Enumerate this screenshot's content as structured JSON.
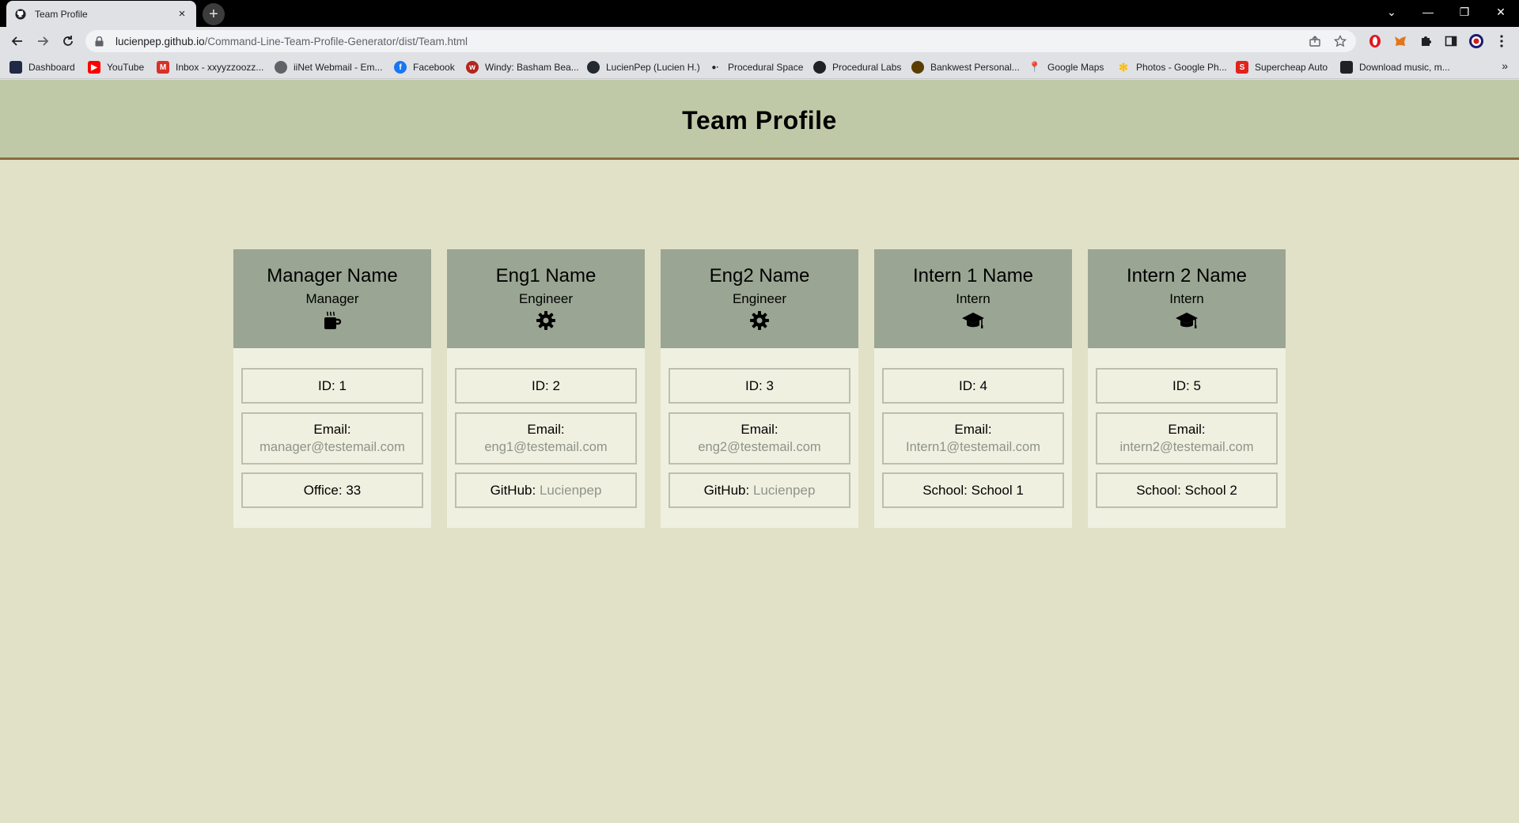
{
  "browser": {
    "tab_title": "Team Profile",
    "tab_close": "×",
    "new_tab": "+",
    "url_host": "lucienpep.github.io",
    "url_path": "/Command-Line-Team-Profile-Generator/dist/Team.html",
    "window_controls": {
      "collapse": "⌄",
      "minimize": "—",
      "restore": "❐",
      "close": "✕"
    },
    "bookmarks": [
      {
        "label": "Dashboard",
        "icon": "dashboard-icon",
        "color": "#1f2a44"
      },
      {
        "label": "YouTube",
        "icon": "youtube-icon",
        "color": "#ff0000"
      },
      {
        "label": "Inbox - xxyyzzoozz...",
        "icon": "gmail-icon",
        "color": "#d93025"
      },
      {
        "label": "iiNet Webmail - Em...",
        "icon": "iinet-icon",
        "color": "#5f6368"
      },
      {
        "label": "Facebook",
        "icon": "facebook-icon",
        "color": "#1877f2"
      },
      {
        "label": "Windy: Basham Bea...",
        "icon": "windy-icon",
        "color": "#b3261e"
      },
      {
        "label": "LucienPep (Lucien H.)",
        "icon": "github-icon",
        "color": "#24292f"
      },
      {
        "label": "Procedural Space",
        "icon": "procedural-space-icon",
        "color": "#202124"
      },
      {
        "label": "Procedural Labs",
        "icon": "procedural-labs-icon",
        "color": "#202124"
      },
      {
        "label": "Bankwest Personal...",
        "icon": "bankwest-icon",
        "color": "#5a3e00"
      },
      {
        "label": "Google Maps",
        "icon": "google-maps-icon",
        "color": "#34a853"
      },
      {
        "label": "Photos - Google Ph...",
        "icon": "google-photos-icon",
        "color": "#fbbc04"
      },
      {
        "label": "Supercheap Auto",
        "icon": "supercheap-icon",
        "color": "#e2231a"
      },
      {
        "label": "Download music, m...",
        "icon": "download-music-icon",
        "color": "#202124"
      }
    ],
    "bookmarks_more": "»"
  },
  "page": {
    "title": "Team Profile",
    "colors": {
      "background": "#e1e1c8",
      "header": "#c0c9a7",
      "header_border": "#8a6c43",
      "card_head": "#9aa693",
      "card_body": "#f0f0e1",
      "muted_text": "#8e9488"
    }
  },
  "team": [
    {
      "name": "Manager Name",
      "role": "Manager",
      "icon": "coffee-mug-icon",
      "id_label": "ID:",
      "id": "1",
      "email_label": "Email:",
      "email": "manager@testemail.com",
      "extra_label": "Office:",
      "extra": "33",
      "extra_muted": false
    },
    {
      "name": "Eng1 Name",
      "role": "Engineer",
      "icon": "gear-icon",
      "id_label": "ID:",
      "id": "2",
      "email_label": "Email:",
      "email": "eng1@testemail.com",
      "extra_label": "GitHub:",
      "extra": "Lucienpep",
      "extra_muted": true
    },
    {
      "name": "Eng2 Name",
      "role": "Engineer",
      "icon": "gear-icon",
      "id_label": "ID:",
      "id": "3",
      "email_label": "Email:",
      "email": "eng2@testemail.com",
      "extra_label": "GitHub:",
      "extra": "Lucienpep",
      "extra_muted": true
    },
    {
      "name": "Intern 1 Name",
      "role": "Intern",
      "icon": "graduation-cap-icon",
      "id_label": "ID:",
      "id": "4",
      "email_label": "Email:",
      "email": "Intern1@testemail.com",
      "extra_label": "School:",
      "extra": "School 1",
      "extra_muted": false
    },
    {
      "name": "Intern 2 Name",
      "role": "Intern",
      "icon": "graduation-cap-icon",
      "id_label": "ID:",
      "id": "5",
      "email_label": "Email:",
      "email": "intern2@testemail.com",
      "extra_label": "School:",
      "extra": "School 2",
      "extra_muted": false
    }
  ]
}
